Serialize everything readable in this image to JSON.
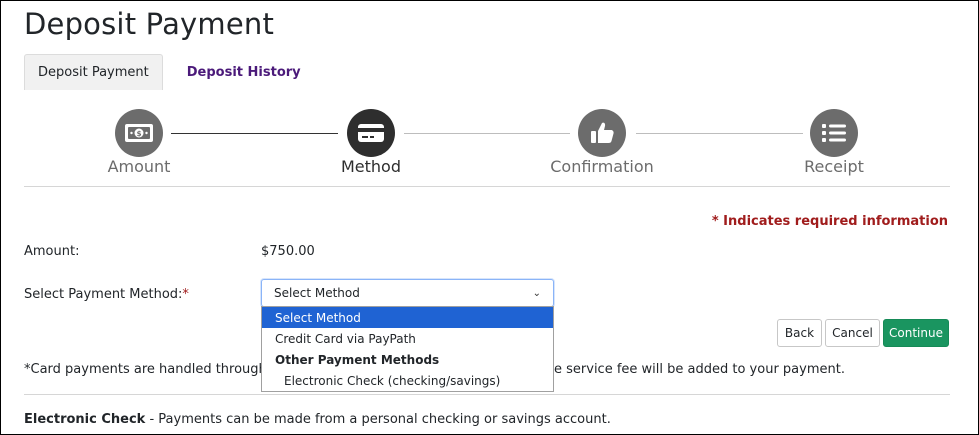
{
  "page": {
    "title": "Deposit Payment"
  },
  "tabs": [
    {
      "label": "Deposit Payment",
      "active": true
    },
    {
      "label": "Deposit History",
      "active": false
    }
  ],
  "steps": [
    {
      "label": "Amount",
      "icon": "money-icon",
      "state": "complete"
    },
    {
      "label": "Method",
      "icon": "credit-card-icon",
      "state": "active"
    },
    {
      "label": "Confirmation",
      "icon": "thumbs-up-icon",
      "state": "pending"
    },
    {
      "label": "Receipt",
      "icon": "list-icon",
      "state": "pending"
    }
  ],
  "required_note": "* Indicates required information",
  "amount": {
    "label": "Amount:",
    "value": "$750.00"
  },
  "payment_method": {
    "label": "Select Payment Method:",
    "required_marker": "*",
    "selected": "Select Method",
    "options": [
      {
        "label": "Select Method",
        "type": "option",
        "selected": true
      },
      {
        "label": "Credit Card via PayPath",
        "type": "option"
      },
      {
        "label": "Other Payment Methods",
        "type": "group"
      },
      {
        "label": "Electronic Check (checking/savings)",
        "type": "child"
      }
    ]
  },
  "buttons": {
    "back": "Back",
    "cancel": "Cancel",
    "continue": "Continue"
  },
  "notes": {
    "card_prefix": "*Card payments are handled through Pay",
    "card_suffix": "e service fee will be added to your payment.",
    "echeck_title": "Electronic Check",
    "echeck_text": " - Payments can be made from a personal checking or savings account."
  },
  "colors": {
    "accent_green": "#1a9560",
    "required_red": "#a01c1c",
    "link_purple": "#4b1a7a",
    "select_blue": "#1f63d3"
  }
}
